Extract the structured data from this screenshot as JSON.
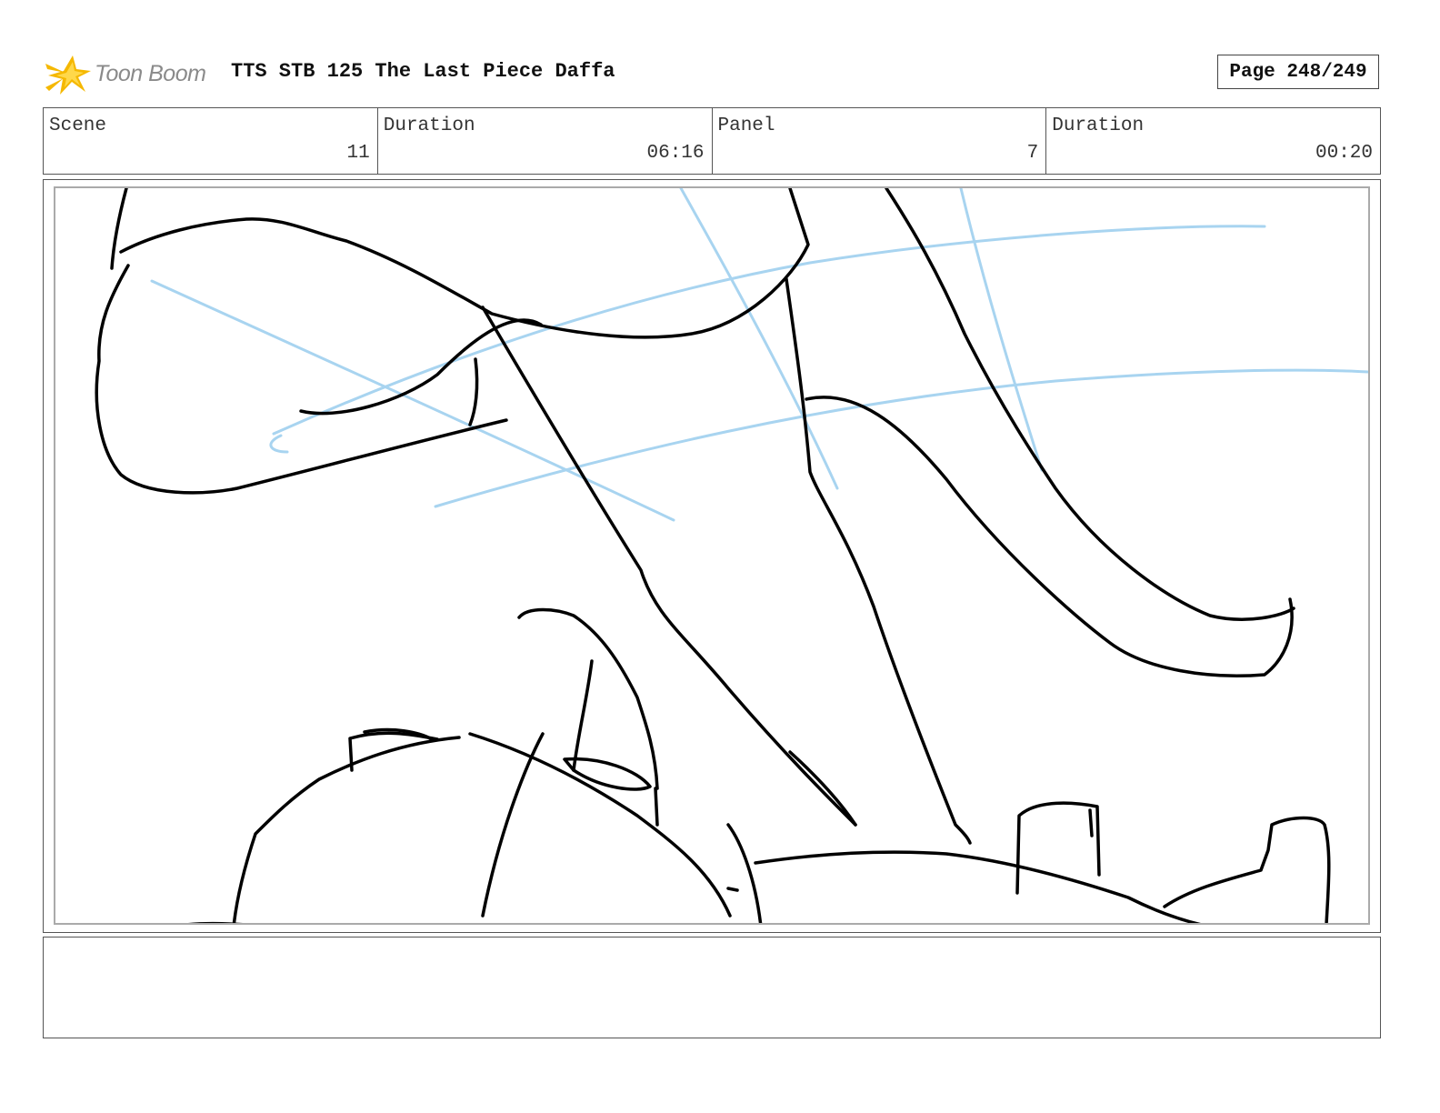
{
  "header": {
    "logo_text": "Toon Boom",
    "title": "TTS STB 125 The Last Piece Daffa",
    "page_indicator": "Page 248/249"
  },
  "info": {
    "scene_label": "Scene",
    "scene_value": "11",
    "scene_duration_label": "Duration",
    "scene_duration_value": "06:16",
    "panel_label": "Panel",
    "panel_value": "7",
    "panel_duration_label": "Duration",
    "panel_duration_value": "00:20"
  },
  "colors": {
    "logo_accent": "#f5b800",
    "sketch_ink": "#000000",
    "sketch_guide": "#a8d4f0"
  },
  "icons": {
    "logo": "toon-boom-logo-icon"
  },
  "notes": {
    "text": ""
  }
}
